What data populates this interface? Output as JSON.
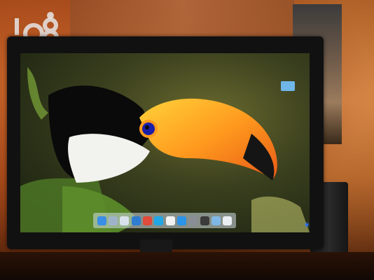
{
  "watermark": {
    "text": "168"
  },
  "screen": {
    "menubar_items": [
      "",
      "",
      "",
      "",
      "",
      ""
    ],
    "desktop_icon": {
      "name": "folder-icon",
      "label": ""
    },
    "dock": {
      "icons": [
        {
          "name": "finder-icon",
          "color": "#3a8ee6"
        },
        {
          "name": "launchpad-icon",
          "color": "#9fb3c8"
        },
        {
          "name": "photo-icon",
          "color": "#d9e2ec"
        },
        {
          "name": "safari-icon",
          "color": "#2f7dd1"
        },
        {
          "name": "chrome-icon",
          "color": "#e14b3b"
        },
        {
          "name": "skype-icon",
          "color": "#1fa7e6"
        },
        {
          "name": "calendar-icon",
          "color": "#f2f2f2"
        },
        {
          "name": "app-store-icon",
          "color": "#2b93e8"
        },
        {
          "name": "system-preferences-icon",
          "color": "#8a8f96"
        },
        {
          "name": "terminal-icon",
          "color": "#3b3b3b"
        },
        {
          "name": "folder-icon",
          "color": "#7fb8e6"
        },
        {
          "name": "trash-icon",
          "color": "#e9eef3"
        }
      ]
    }
  },
  "monitor": {
    "brand": ""
  }
}
